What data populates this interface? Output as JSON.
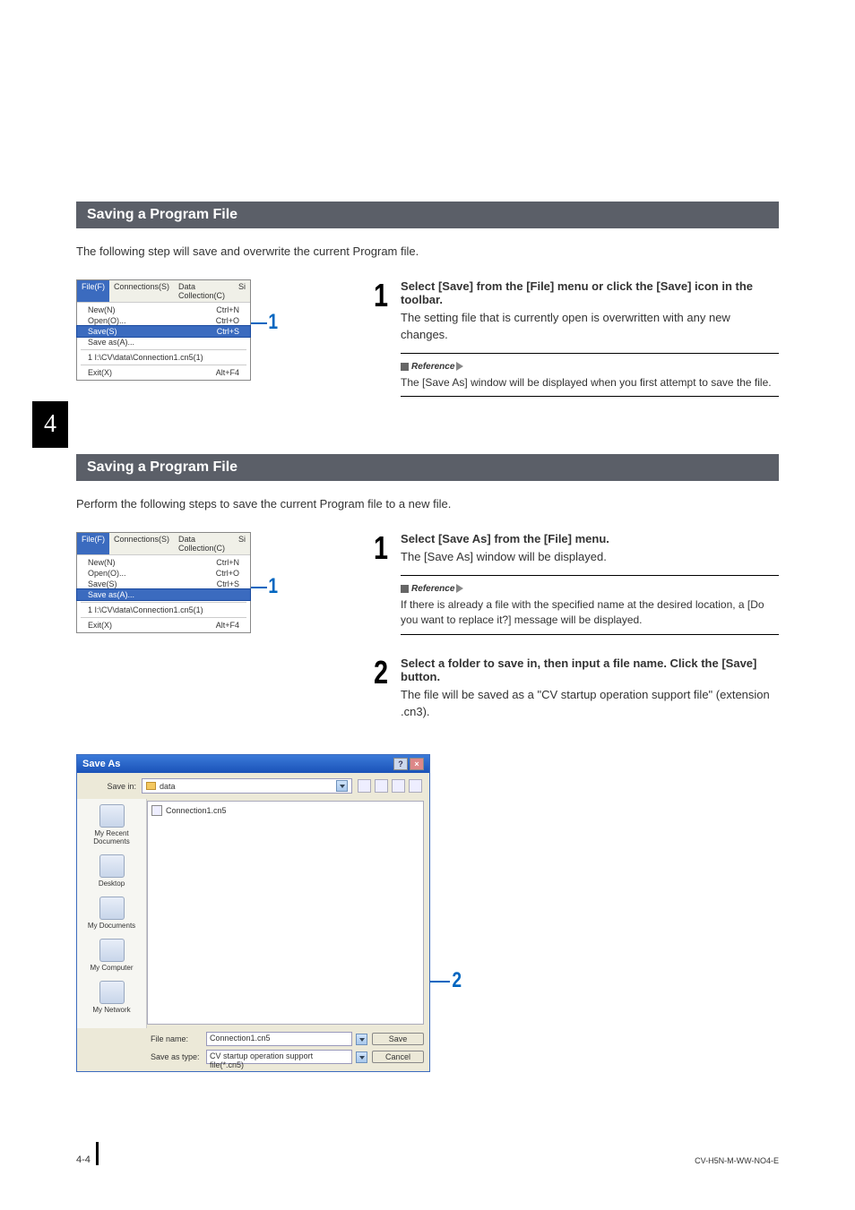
{
  "chapter_tab": "4",
  "sections": [
    {
      "title": "Saving a Program File",
      "intro": "The following step will save and overwrite the current Program file."
    },
    {
      "title": "Saving a Program File",
      "intro": "Perform the following steps to save the current Program file to a new file."
    }
  ],
  "file_menu": {
    "menubar": [
      "File(F)",
      "Connections(S)",
      "Data Collection(C)",
      "Si"
    ],
    "items": [
      {
        "label": "New(N)",
        "shortcut": "Ctrl+N"
      },
      {
        "label": "Open(O)...",
        "shortcut": "Ctrl+O"
      },
      {
        "label": "Save(S)",
        "shortcut": "Ctrl+S"
      },
      {
        "label": "Save as(A)...",
        "shortcut": ""
      }
    ],
    "recent": "1 I:\\CV\\data\\Connection1.cn5(1)",
    "exit": {
      "label": "Exit(X)",
      "shortcut": "Alt+F4"
    }
  },
  "callout_1": "1",
  "steps_a": {
    "num": "1",
    "title": "Select [Save] from the [File] menu or click the [Save] icon in the toolbar.",
    "desc": "The setting file that is currently open is overwritten with any new changes.",
    "ref_label": "Reference",
    "ref_text": "The [Save As] window will be displayed when you first attempt to save the file."
  },
  "steps_b1": {
    "num": "1",
    "title": "Select [Save As] from the [File] menu.",
    "desc": "The [Save As] window will be displayed.",
    "ref_label": "Reference",
    "ref_text": "If there is already a file with the specified name at the desired location, a [Do you want to replace it?] message will be displayed."
  },
  "steps_b2": {
    "num": "2",
    "title": "Select a folder to save in, then input a file name. Click the [Save] button.",
    "desc": "The file will be saved as a \"CV startup operation support file\" (extension .cn3)."
  },
  "saveas": {
    "title": "Save As",
    "save_in_label": "Save in:",
    "folder": "data",
    "file_in_list": "Connection1.cn5",
    "sidebar": [
      "My Recent Documents",
      "Desktop",
      "My Documents",
      "My Computer",
      "My Network"
    ],
    "file_name_label": "File name:",
    "file_name_value": "Connection1.cn5",
    "save_type_label": "Save as type:",
    "save_type_value": "CV startup operation support file(*.cn5)",
    "save_btn": "Save",
    "cancel_btn": "Cancel",
    "callout": "2"
  },
  "footer": {
    "page": "4-4",
    "doc_id": "CV-H5N-M-WW-NO4-E"
  }
}
